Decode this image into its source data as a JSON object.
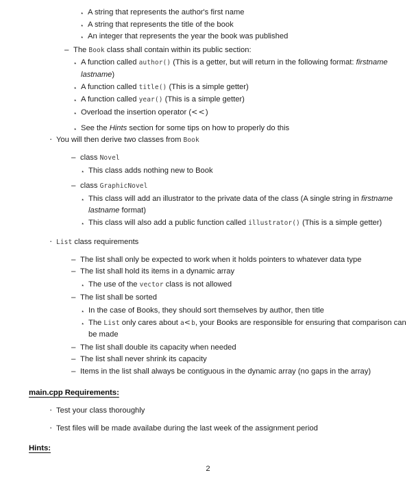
{
  "document": {
    "page_number": "2",
    "bullet_glyphs": {
      "level1": "·",
      "level2": "–",
      "level3": "⋆"
    }
  },
  "book_members": {
    "items": [
      "A string that represents the author's first name",
      "A string that represents the title of the book",
      "An integer that represents the year the book was published"
    ]
  },
  "book_public": {
    "lead_before": "The ",
    "lead_code": "Book",
    "lead_after": " class shall contain within its public section:",
    "author_fn": {
      "before": "A function called ",
      "code": "author()",
      "after": " (This is a getter, but will return in the following format: ",
      "italic": "firstname lastname",
      "tail": ")"
    },
    "title_fn": {
      "before": "A function called ",
      "code": "title()",
      "after": " (This is a simple getter)"
    },
    "year_fn": {
      "before": "A function called ",
      "code": "year()",
      "after": " (This is a simple getter)"
    },
    "insertion_operator": {
      "before": "Overload the insertion operator (",
      "math": "<<",
      "after": ")"
    },
    "hints_note": {
      "before": "See the ",
      "italic": "Hints",
      "after": " section for some tips on how to properly do this"
    }
  },
  "derived": {
    "lead_before": "You will then derive two classes from ",
    "lead_code": "Book",
    "novel": {
      "label": "class ",
      "code": "Novel",
      "note": "This class adds nothing new to Book"
    },
    "graphic_novel": {
      "label": "class ",
      "code": "GraphicNovel",
      "illustrator_data": {
        "before": "This class will add an illustrator to the private data of the class (A single string in ",
        "italic": "firstname lastname",
        "after": " format)"
      },
      "illustrator_fn": {
        "before": "This class will also add a public function called ",
        "code": "illustrator()",
        "after": " (This is a simple getter)"
      }
    }
  },
  "list_class": {
    "lead_code": "List",
    "lead_after": " class requirements",
    "pointers": "The list shall only be expected to work when it holds pointers to whatever data type",
    "dynamic_array": "The list shall hold its items in a dynamic array",
    "no_vector": {
      "before": "The use of the ",
      "code": "vector",
      "after": " class is not allowed"
    },
    "sorted": "The list shall be sorted",
    "sort_books": "In the case of Books, they should sort themselves by author, then title",
    "comparison": {
      "before": "The ",
      "code": "List",
      "mid": " only cares about ",
      "var_a": "a",
      "op": "<",
      "var_b": "b",
      "after": ", your Books are responsible for ensuring that comparison can be made"
    },
    "double_capacity": "The list shall double its capacity when needed",
    "never_shrink": "The list shall never shrink its capacity",
    "contiguous": "Items in the list shall always be contiguous in the dynamic array (no gaps in the array)"
  },
  "main_cpp": {
    "heading": "main.cpp Requirements:",
    "items": [
      "Test your class thoroughly",
      "Test files will be made availabe during the last week of the assignment period"
    ]
  },
  "hints": {
    "heading": "Hints:"
  }
}
